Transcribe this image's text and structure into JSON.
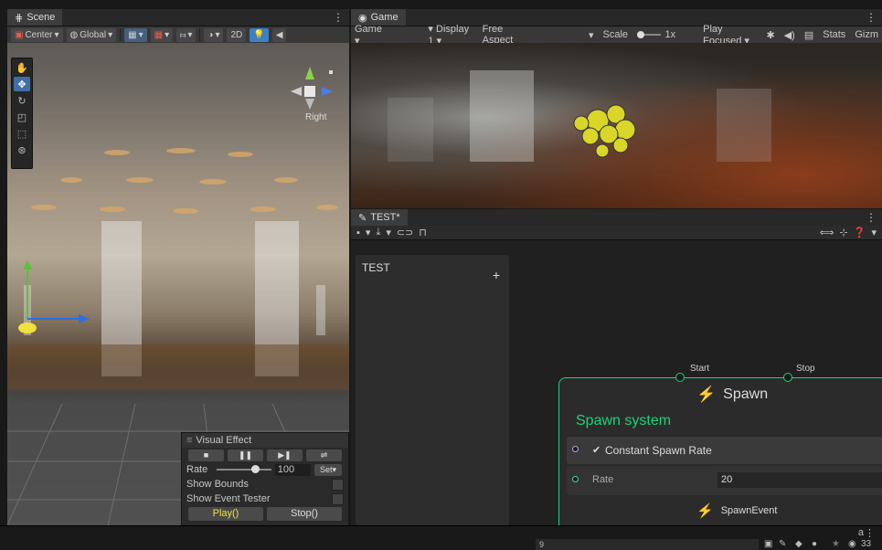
{
  "scene": {
    "tab_label": "Scene",
    "pivot_mode": "Center",
    "pivot_rotation": "Global",
    "view_2d": "2D",
    "gizmo_label": "Right"
  },
  "visual_effect": {
    "title": "Visual Effect",
    "rate_label": "Rate",
    "rate_value": "100",
    "set_label": "Set",
    "show_bounds_label": "Show Bounds",
    "show_event_tester_label": "Show Event Tester",
    "play_label": "Play()",
    "stop_label": "Stop()"
  },
  "game": {
    "tab_label": "Game",
    "mode": "Game",
    "display": "Display 1",
    "aspect": "Free Aspect",
    "scale_label": "Scale",
    "scale_value": "1x",
    "play_mode": "Play Focused",
    "stats_label": "Stats",
    "gizmos_label": "Gizm"
  },
  "graph": {
    "tab_label": "TEST*",
    "blackboard_title": "TEST",
    "blackboard_add": "+",
    "start_label": "Start",
    "stop_label": "Stop",
    "spawn_title": "Spawn",
    "spawn_system_label": "Spawn system",
    "constant_spawn_rate": "Constant Spawn Rate",
    "rate_label": "Rate",
    "rate_value": "20",
    "spawn_event_label": "SpawnEvent"
  },
  "status": {
    "search_value": "9",
    "count_label": "33"
  },
  "colors": {
    "accent_green": "#1fd07a",
    "play_highlight": "#f0e23c",
    "selection_blue": "#3f6ea8"
  }
}
